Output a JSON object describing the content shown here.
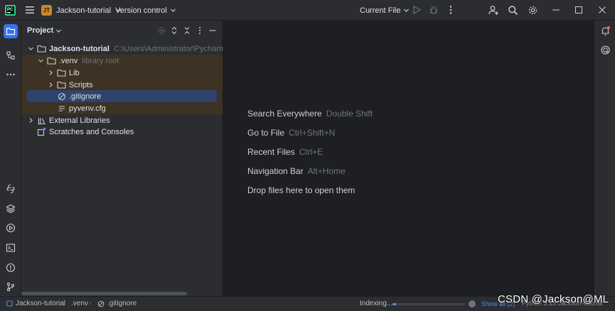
{
  "titlebar": {
    "project_badge": "JT",
    "project_name": "Jackson-tutorial",
    "vcs_label": "Version control",
    "run_config": "Current File"
  },
  "project_panel": {
    "title": "Project",
    "tree": [
      {
        "label": "Jackson-tutorial",
        "hint": "C:\\Users\\Administrator\\PycharmProjects\\Jac",
        "icon": "folder-icon",
        "expanded": true
      },
      {
        "label": ".venv",
        "hint": "library root",
        "icon": "folder-icon",
        "expanded": true
      },
      {
        "label": "Lib",
        "icon": "folder-icon",
        "expanded": false
      },
      {
        "label": "Scripts",
        "icon": "folder-icon",
        "expanded": false
      },
      {
        "label": ".gitignore",
        "icon": "ignored-file-icon",
        "selected": true
      },
      {
        "label": "pyvenv.cfg",
        "icon": "config-file-icon"
      },
      {
        "label": "External Libraries",
        "icon": "library-icon",
        "expanded": false
      },
      {
        "label": "Scratches and Consoles",
        "icon": "scratch-icon"
      }
    ]
  },
  "editor_hints": [
    {
      "action": "Search Everywhere",
      "shortcut": "Double Shift"
    },
    {
      "action": "Go to File",
      "shortcut": "Ctrl+Shift+N"
    },
    {
      "action": "Recent Files",
      "shortcut": "Ctrl+E"
    },
    {
      "action": "Navigation Bar",
      "shortcut": "Alt+Home"
    },
    {
      "action": "Drop files here to open them",
      "shortcut": ""
    }
  ],
  "statusbar": {
    "breadcrumbs": [
      "Jackson-tutorial",
      ".venv",
      ".gitignore"
    ],
    "indexing_label": "Indexing...",
    "indexing_progress": 0.05,
    "show_all": "Show all (2)",
    "interpreter": "Python 3.13 Jackson-tutorial"
  },
  "watermark": "CSDN @Jackson@ML",
  "colors": {
    "accent": "#3574f0",
    "project_badge": "#c9882e",
    "selection": "#2e436e",
    "venv_highlight": "#3d3223"
  }
}
